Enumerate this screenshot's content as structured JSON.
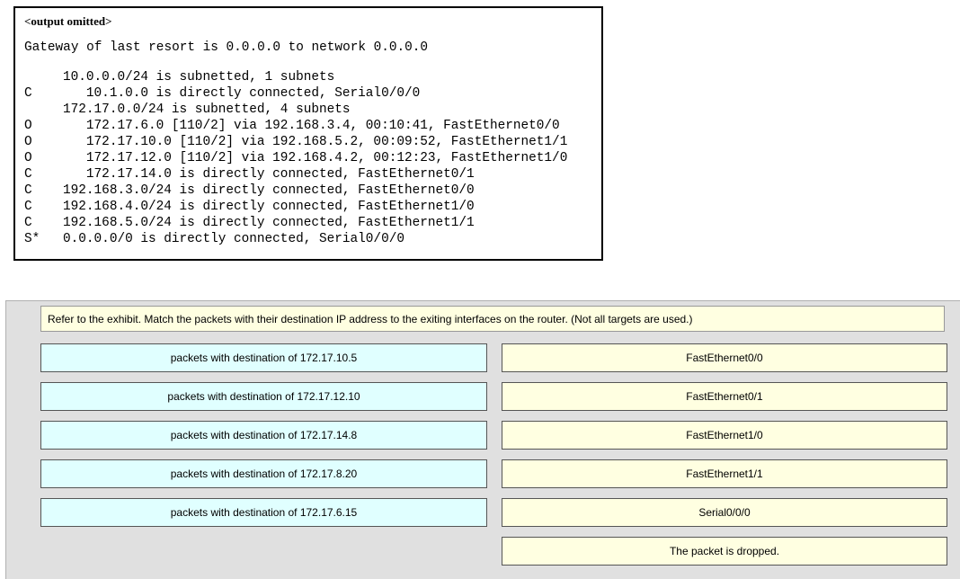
{
  "exhibit": {
    "header": "<output omitted>",
    "gateway": "Gateway of last resort is 0.0.0.0 to network 0.0.0.0",
    "routes": [
      {
        "code": "",
        "text": "10.0.0.0/24 is subnetted, 1 subnets"
      },
      {
        "code": "C",
        "text": "   10.1.0.0 is directly connected, Serial0/0/0"
      },
      {
        "code": "",
        "text": "172.17.0.0/24 is subnetted, 4 subnets"
      },
      {
        "code": "O",
        "text": "   172.17.6.0 [110/2] via 192.168.3.4, 00:10:41, FastEthernet0/0"
      },
      {
        "code": "O",
        "text": "   172.17.10.0 [110/2] via 192.168.5.2, 00:09:52, FastEthernet1/1"
      },
      {
        "code": "O",
        "text": "   172.17.12.0 [110/2] via 192.168.4.2, 00:12:23, FastEthernet1/0"
      },
      {
        "code": "C",
        "text": "   172.17.14.0 is directly connected, FastEthernet0/1"
      },
      {
        "code": "C",
        "text": "192.168.3.0/24 is directly connected, FastEthernet0/0"
      },
      {
        "code": "C",
        "text": "192.168.4.0/24 is directly connected, FastEthernet1/0"
      },
      {
        "code": "C",
        "text": "192.168.5.0/24 is directly connected, FastEthernet1/1"
      },
      {
        "code": "S*",
        "text": "0.0.0.0/0 is directly connected, Serial0/0/0"
      }
    ]
  },
  "activity": {
    "instructions": "Refer to the exhibit. Match the packets with their destination IP address to the exiting interfaces on the router. (Not all targets are used.)",
    "packets": [
      "packets with destination of 172.17.10.5",
      "packets with destination of 172.17.12.10",
      "packets with destination of 172.17.14.8",
      "packets with destination of 172.17.8.20",
      "packets with destination of 172.17.6.15"
    ],
    "targets": [
      "FastEthernet0/0",
      "FastEthernet0/1",
      "FastEthernet1/0",
      "FastEthernet1/1",
      "Serial0/0/0",
      "The packet is dropped."
    ]
  },
  "colors": {
    "packet_card": "#e0ffff",
    "target_card": "#ffffe1",
    "panel_bg": "#e0e0e0"
  }
}
